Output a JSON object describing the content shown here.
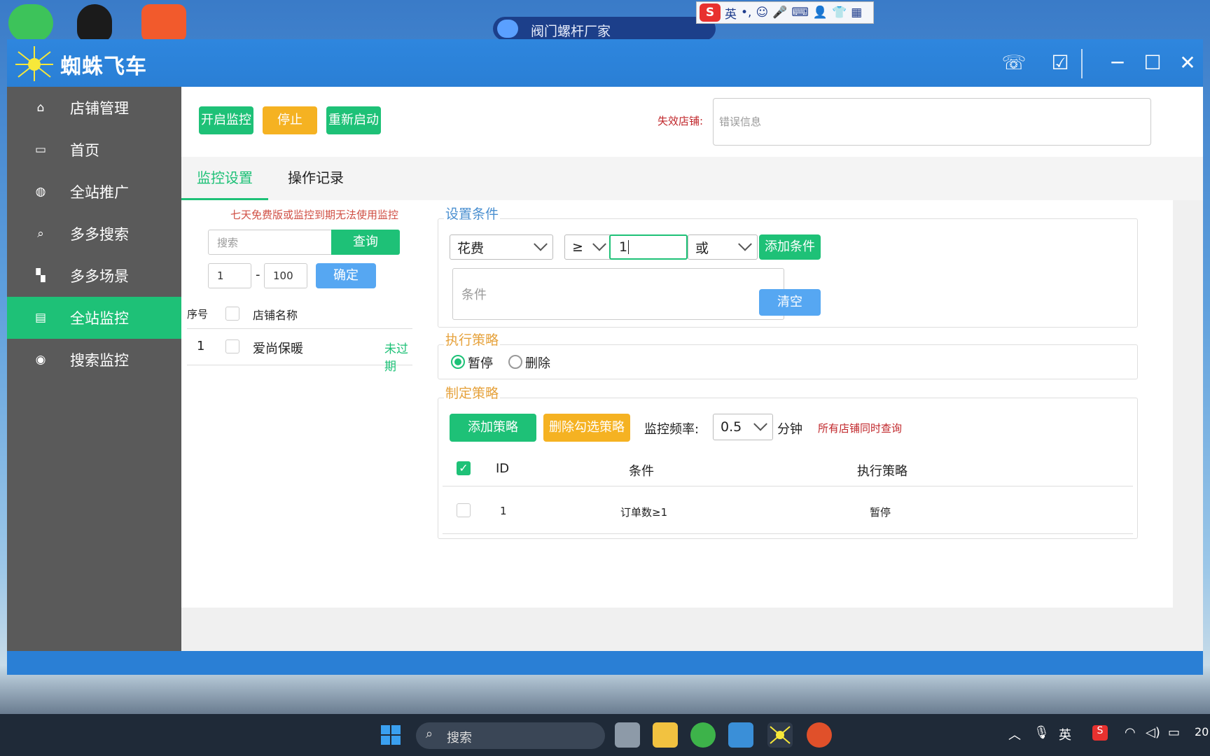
{
  "desktop": {
    "float_bar_title": "阀门螺杆厂家",
    "ime_label": "英"
  },
  "app": {
    "title": "蜘蛛飞车",
    "colors": {
      "primary": "#2e86de",
      "accent_green": "#1ec177",
      "warn_orange": "#f5b222",
      "blue": "#56a7f2"
    }
  },
  "sidebar": {
    "items": [
      {
        "label": "店铺管理",
        "icon": "home-icon"
      },
      {
        "label": "首页",
        "icon": "store-icon"
      },
      {
        "label": "全站推广",
        "icon": "planet-icon"
      },
      {
        "label": "多多搜索",
        "icon": "search-icon"
      },
      {
        "label": "多多场景",
        "icon": "grid-icon"
      },
      {
        "label": "全站监控",
        "icon": "monitor-icon"
      },
      {
        "label": "搜索监控",
        "icon": "webcam-icon"
      }
    ],
    "active_index": 5
  },
  "toolbar": {
    "start_label": "开启监控",
    "stop_label": "停止",
    "restart_label": "重新启动",
    "invalid_store_label": "失效店铺:",
    "error_placeholder": "错误信息"
  },
  "tabs": [
    {
      "label": "监控设置"
    },
    {
      "label": "操作记录"
    }
  ],
  "left_panel": {
    "warning": "七天免费版或监控到期无法使用监控",
    "search_placeholder": "搜索",
    "query_label": "查询",
    "range_from": "1",
    "range_sep": "-",
    "range_to": "100",
    "confirm_label": "确定",
    "headers": {
      "index": "序号",
      "store_name": "店铺名称"
    },
    "rows": [
      {
        "index": "1",
        "name": "爱尚保暖",
        "status": "未过期"
      }
    ]
  },
  "conditions": {
    "title": "设置条件",
    "metric": "花费",
    "operator": "≥",
    "value": "1",
    "logic": "或",
    "add_label": "添加条件",
    "condition_placeholder": "条件",
    "clear_label": "清空"
  },
  "execution": {
    "title": "执行策略",
    "options": [
      "暂停",
      "删除"
    ],
    "selected": "暂停"
  },
  "policy": {
    "title": "制定策略",
    "add_label": "添加策略",
    "delete_label": "删除勾选策略",
    "freq_label": "监控频率:",
    "freq_value": "0.5",
    "freq_unit": "分钟",
    "note": "所有店铺同时查询",
    "headers": {
      "id": "ID",
      "condition": "条件",
      "strategy": "执行策略"
    },
    "rows": [
      {
        "id": "1",
        "condition": "订单数≥1",
        "strategy": "暂停"
      }
    ]
  },
  "taskbar": {
    "search_label": "搜索",
    "lang": "英",
    "clock_fragment": "20"
  }
}
